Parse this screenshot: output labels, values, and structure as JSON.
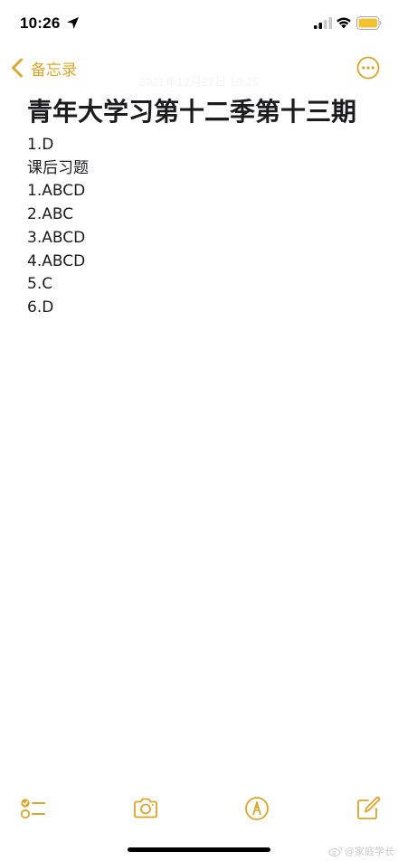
{
  "status_bar": {
    "time": "10:26",
    "icons": [
      "location-arrow-icon",
      "cellular-signal-icon",
      "wifi-icon",
      "battery-icon"
    ],
    "battery_color": "#f2c230"
  },
  "nav": {
    "back_label": "备忘录",
    "date": "2021年12月27日 10:25",
    "more_icon": "ellipsis-circle-icon"
  },
  "accent_color": "#d9a52b",
  "note": {
    "title": "青年大学习第十二季第十三期",
    "lines": [
      "1.D",
      "课后习题",
      "1.ABCD",
      "2.ABC",
      "3.ABCD",
      "4.ABCD",
      "5.C",
      "6.D"
    ]
  },
  "toolbar": {
    "items": [
      {
        "icon": "checklist-icon"
      },
      {
        "icon": "camera-icon"
      },
      {
        "icon": "markup-pen-icon"
      },
      {
        "icon": "compose-icon"
      }
    ]
  },
  "watermark": {
    "text": "@家庭学长"
  }
}
